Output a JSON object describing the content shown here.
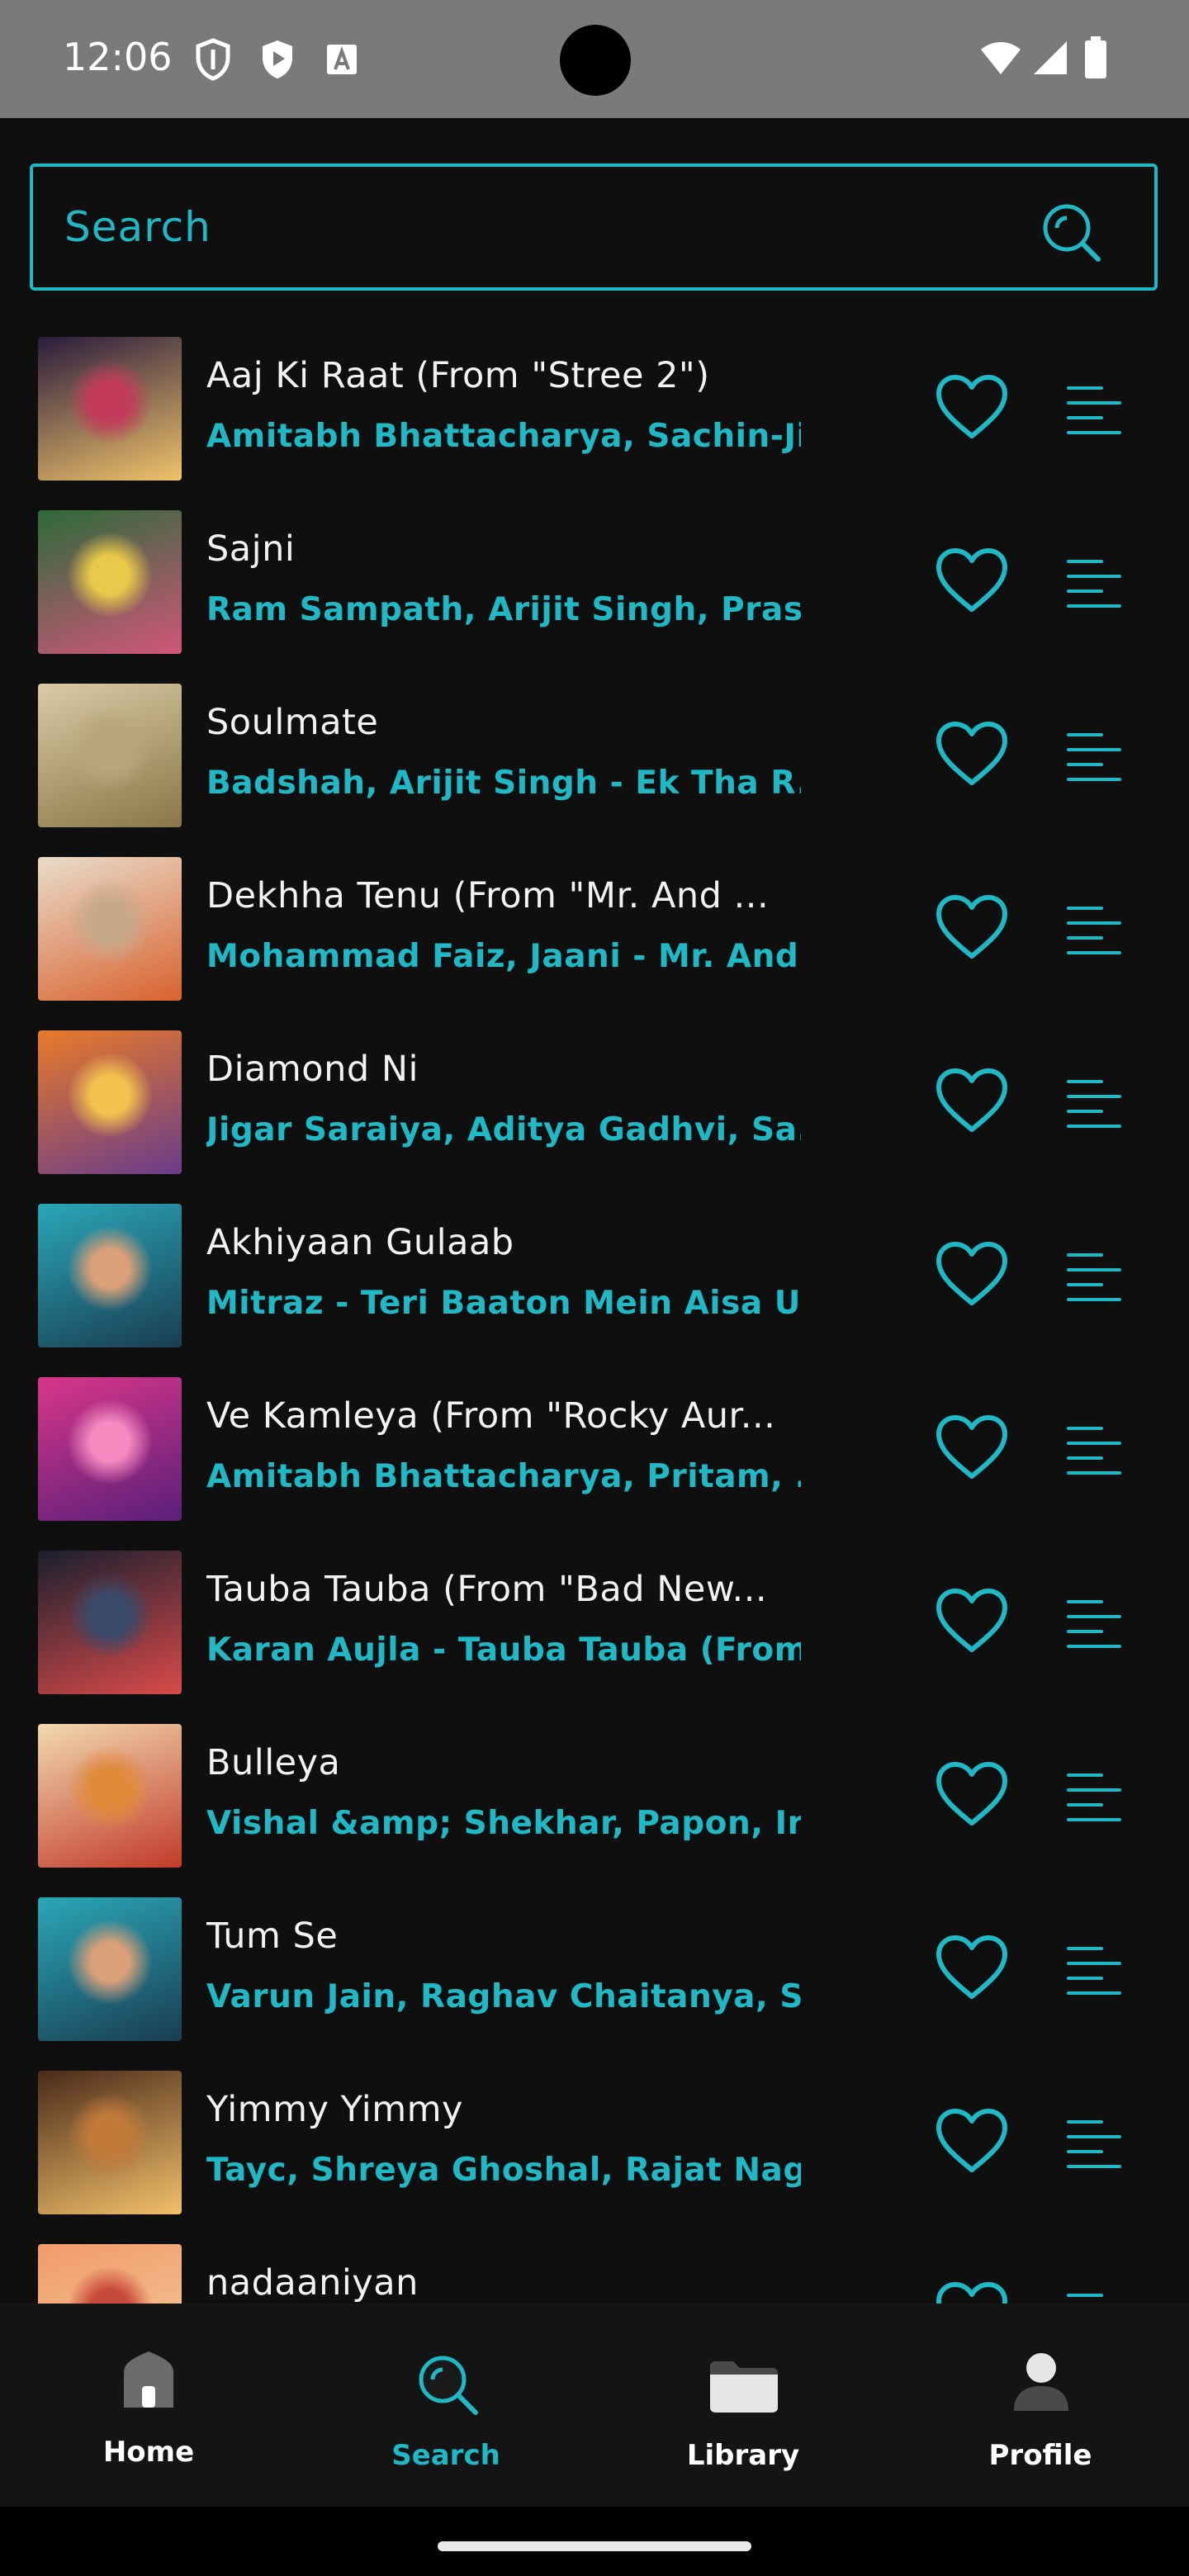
{
  "status_bar": {
    "time": "12:06",
    "icons": [
      "shield-outline-icon",
      "play-protect-icon",
      "keyboard-a-icon",
      "wifi-icon",
      "signal-icon",
      "battery-icon"
    ]
  },
  "search": {
    "placeholder": "Search"
  },
  "colors": {
    "accent": "#1fb8c4",
    "background": "#0f0f0f",
    "nav_background": "#141414",
    "status_bar": "#7a7a7a"
  },
  "songs": [
    {
      "title": "Aaj Ki Raat (From \"Stree 2\")",
      "subtitle": "Amitabh Bhattacharya, Sachin-Ji...",
      "art_colors": [
        "#2a1b3d",
        "#c23b5a",
        "#f0c36a"
      ]
    },
    {
      "title": "Sajni",
      "subtitle": "Ram Sampath, Arijit Singh, Pras...",
      "art_colors": [
        "#2d6a3a",
        "#e8c94a",
        "#d1567a"
      ]
    },
    {
      "title": "Soulmate",
      "subtitle": "Badshah, Arijit Singh - Ek Tha R...",
      "art_colors": [
        "#d9cba6",
        "#b8a67d",
        "#8a7648"
      ]
    },
    {
      "title": "Dekhha Tenu (From \"Mr. And ...",
      "subtitle": "Mohammad Faiz, Jaani - Mr. And...",
      "art_colors": [
        "#e9dccb",
        "#c8a88a",
        "#d9622e"
      ]
    },
    {
      "title": "Diamond Ni",
      "subtitle": "Jigar Saraiya, Aditya Gadhvi, Sa...",
      "art_colors": [
        "#e87a2a",
        "#f2c14e",
        "#6a3c8a"
      ]
    },
    {
      "title": "Akhiyaan Gulaab",
      "subtitle": "Mitraz - Teri Baaton Mein Aisa Ul...",
      "art_colors": [
        "#2aa7b8",
        "#d9a07a",
        "#1a3d52"
      ]
    },
    {
      "title": "Ve Kamleya (From \"Rocky Aur...",
      "subtitle": "Amitabh Bhattacharya, Pritam, ...",
      "art_colors": [
        "#d8368a",
        "#f58ac0",
        "#5a1f7a"
      ]
    },
    {
      "title": "Tauba Tauba (From \"Bad New...",
      "subtitle": "Karan Aujla - Tauba Tauba (From...",
      "art_colors": [
        "#1a1f2e",
        "#3a4a6a",
        "#d94a4a"
      ]
    },
    {
      "title": "Bulleya",
      "subtitle": "Vishal &amp; Shekhar, Papon, Irs...",
      "art_colors": [
        "#f2d9b0",
        "#e08a3a",
        "#c23a2a"
      ]
    },
    {
      "title": "Tum Se",
      "subtitle": "Varun Jain, Raghav Chaitanya, S...",
      "art_colors": [
        "#2aa7b8",
        "#d9a07a",
        "#1a3d52"
      ]
    },
    {
      "title": "Yimmy Yimmy",
      "subtitle": "Tayc, Shreya Ghoshal, Rajat Nag...",
      "art_colors": [
        "#4a2a1a",
        "#c27a3a",
        "#f2c06a"
      ]
    },
    {
      "title": "nadaaniyan",
      "subtitle": "",
      "art_colors": [
        "#f29a6a",
        "#c84a3a",
        "#f2d0a0"
      ]
    }
  ],
  "nav": {
    "items": [
      {
        "label": "Home",
        "icon": "home-icon",
        "active": false
      },
      {
        "label": "Search",
        "icon": "search-icon",
        "active": true
      },
      {
        "label": "Library",
        "icon": "folder-icon",
        "active": false
      },
      {
        "label": "Profile",
        "icon": "person-icon",
        "active": false
      }
    ]
  }
}
